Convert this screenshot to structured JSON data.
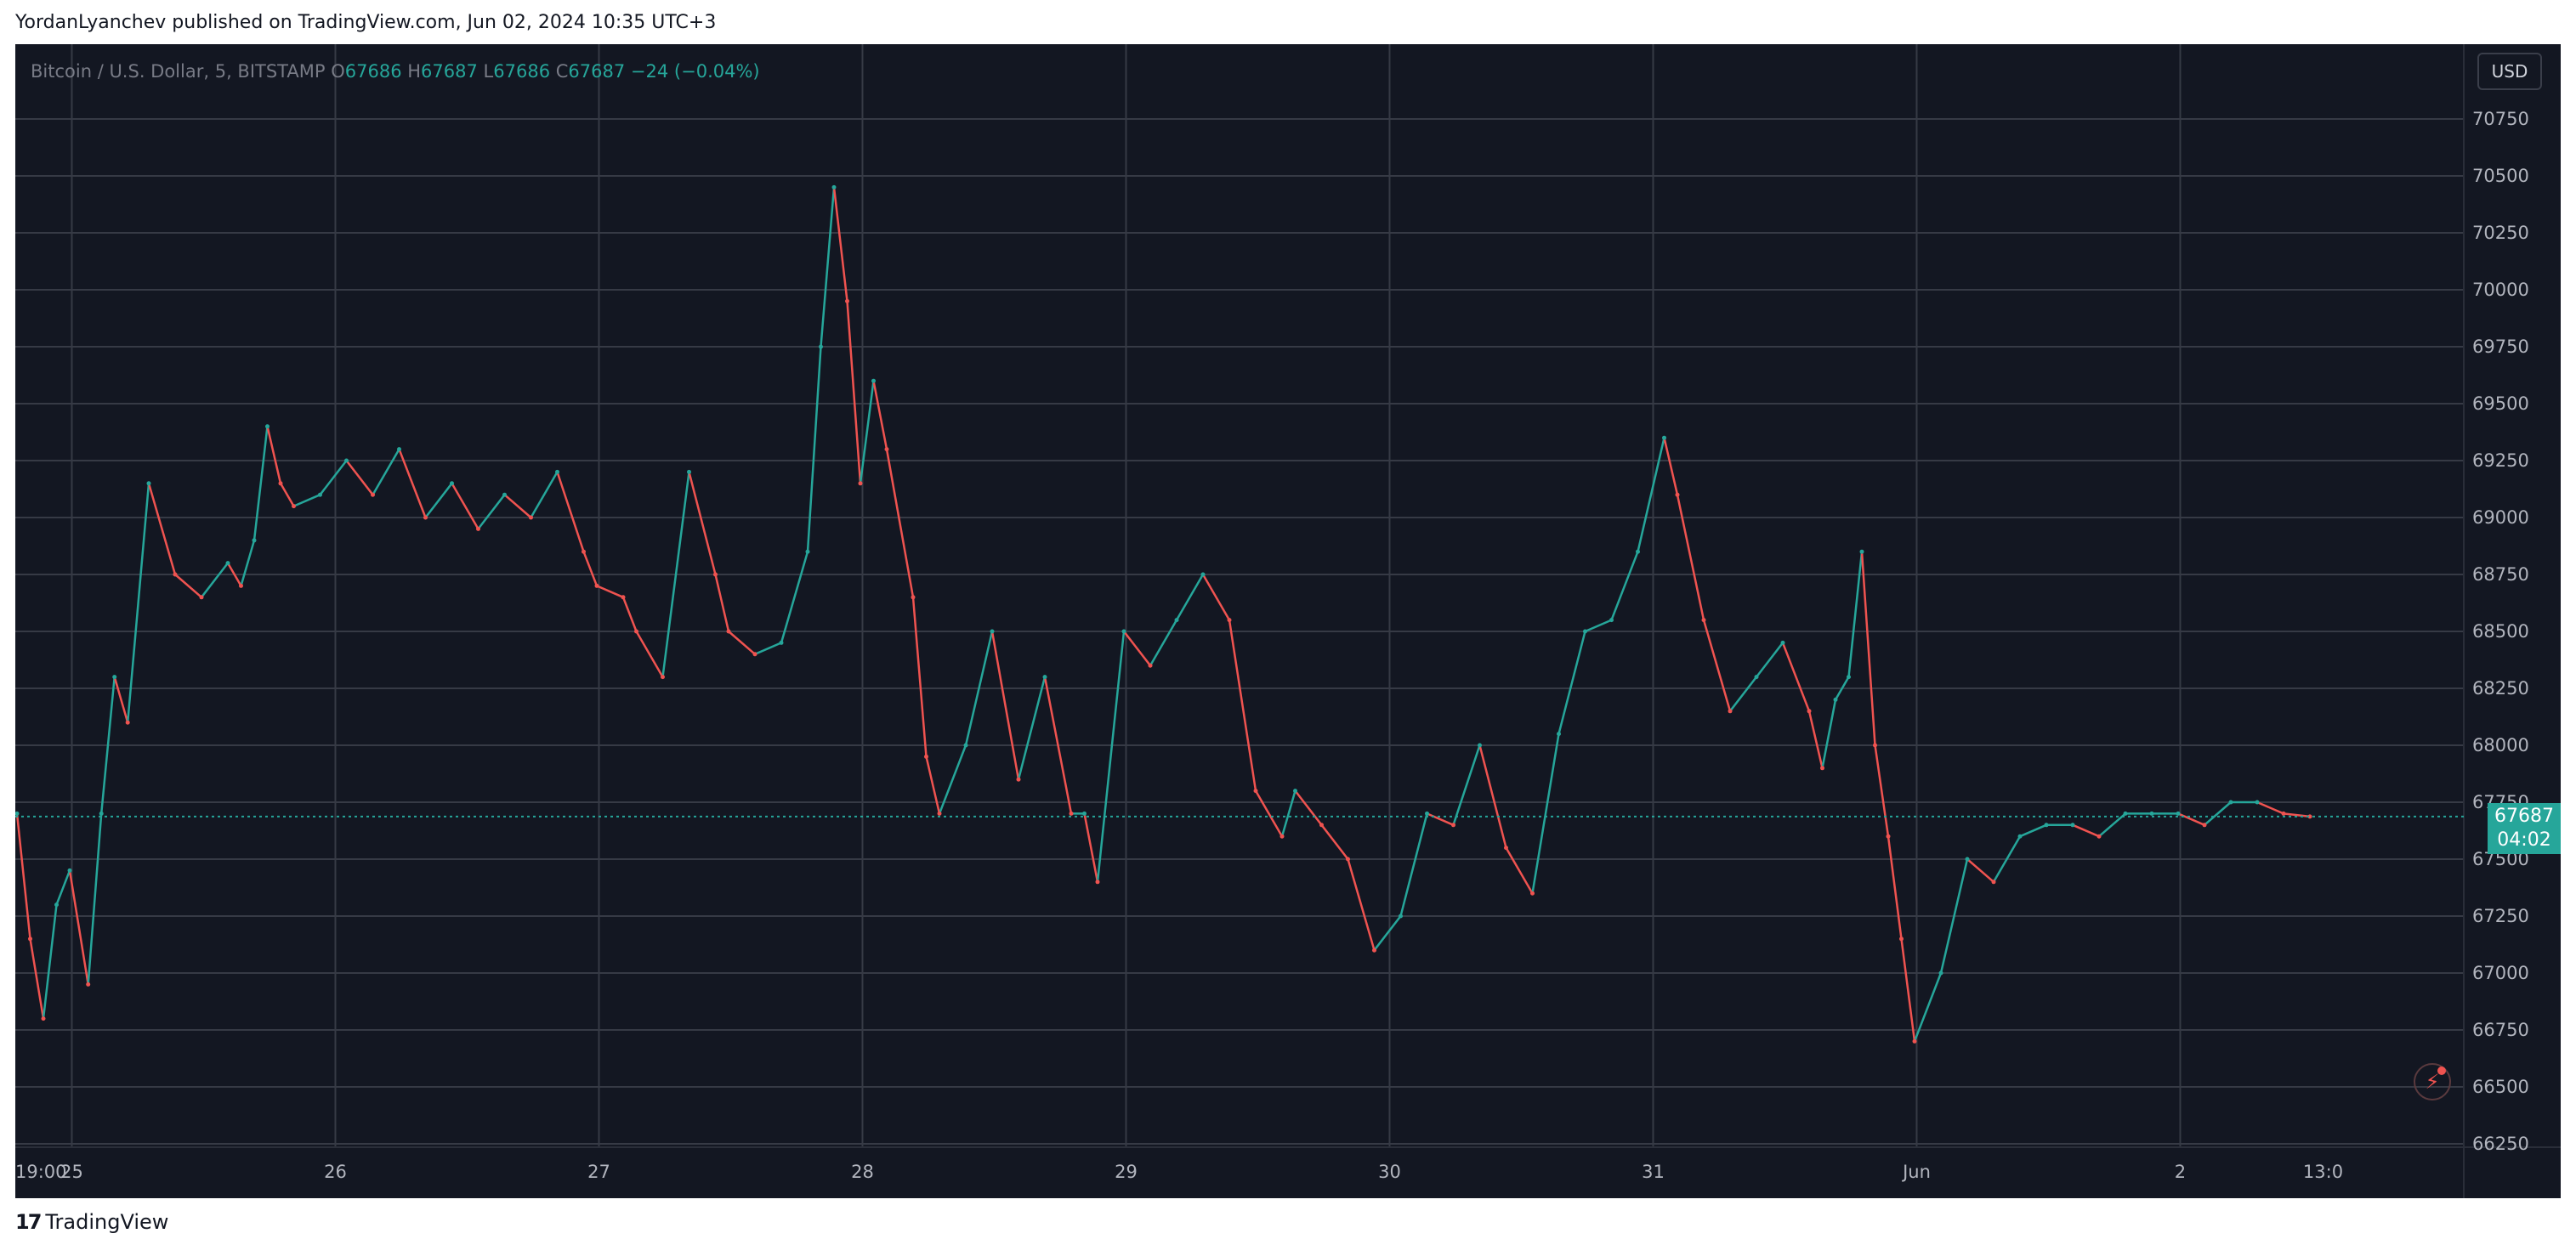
{
  "header": {
    "text": "YordanLyanchev published on TradingView.com, Jun 02, 2024 10:35 UTC+3"
  },
  "legend": {
    "symbol": "Bitcoin / U.S. Dollar, 5, BITSTAMP",
    "o_label": "O",
    "o_value": "67686",
    "h_label": "H",
    "h_value": "67687",
    "l_label": "L",
    "l_value": "67686",
    "c_label": "C",
    "c_value": "67687",
    "change": "−24 (−0.04%)"
  },
  "currency_button": "USD",
  "last_price": {
    "value": "67687",
    "countdown": "04:02"
  },
  "colors": {
    "up": "#26a69a",
    "down": "#ef5350",
    "background": "#131722",
    "grid": "#363a45",
    "axis_text": "#b2b5be"
  },
  "icons": {
    "alert": "lightning-bolt-icon",
    "logo": "tradingview-logo-icon"
  },
  "footer": {
    "brand": "TradingView"
  },
  "chart_data": {
    "type": "line",
    "title": "Bitcoin / U.S. Dollar, 5, BITSTAMP",
    "xlabel": "",
    "ylabel": "",
    "ylim": [
      66250,
      70750
    ],
    "y_ticks": [
      66250,
      66500,
      66750,
      67000,
      67250,
      67500,
      67750,
      68000,
      68250,
      68500,
      68750,
      69000,
      69250,
      69500,
      69750,
      70000,
      70250,
      70500,
      70750
    ],
    "x_ticks": [
      {
        "label": "19:00",
        "x": 0.0
      },
      {
        "label": "25",
        "x": 0.208
      },
      {
        "label": "26",
        "x": 1.208
      },
      {
        "label": "27",
        "x": 2.208
      },
      {
        "label": "28",
        "x": 3.208
      },
      {
        "label": "29",
        "x": 4.208
      },
      {
        "label": "30",
        "x": 5.208
      },
      {
        "label": "31",
        "x": 6.208
      },
      {
        "label": "Jun",
        "x": 7.208
      },
      {
        "label": "2",
        "x": 8.208
      },
      {
        "label": "13:0",
        "x": 8.75
      }
    ],
    "grid": true,
    "last_value": 67687,
    "series": [
      {
        "x": [
          0.0,
          0.05,
          0.1,
          0.15,
          0.2,
          0.27,
          0.32,
          0.37,
          0.42,
          0.5,
          0.6,
          0.7,
          0.8,
          0.85,
          0.9,
          0.95,
          1.0,
          1.05,
          1.15,
          1.25,
          1.35,
          1.45,
          1.55,
          1.65,
          1.75,
          1.85,
          1.95,
          2.05,
          2.15,
          2.2,
          2.3,
          2.35,
          2.45,
          2.55,
          2.65,
          2.7,
          2.8,
          2.9,
          3.0,
          3.05,
          3.1,
          3.15,
          3.2,
          3.25,
          3.3,
          3.4,
          3.45,
          3.5,
          3.6,
          3.7,
          3.8,
          3.9,
          4.0,
          4.05,
          4.1,
          4.2,
          4.3,
          4.4,
          4.5,
          4.6,
          4.7,
          4.8,
          4.85,
          4.95,
          5.05,
          5.15,
          5.25,
          5.35,
          5.45,
          5.55,
          5.65,
          5.75,
          5.85,
          5.95,
          6.05,
          6.15,
          6.25,
          6.3,
          6.4,
          6.5,
          6.6,
          6.7,
          6.8,
          6.85,
          6.9,
          6.95,
          7.0,
          7.05,
          7.1,
          7.15,
          7.2,
          7.3,
          7.4,
          7.5,
          7.6,
          7.7,
          7.8,
          7.9,
          8.0,
          8.1,
          8.2,
          8.3,
          8.4,
          8.5,
          8.6,
          8.7
        ],
        "values": [
          67700,
          67150,
          66800,
          67300,
          67450,
          66950,
          67700,
          68300,
          68100,
          69150,
          68750,
          68650,
          68800,
          68700,
          68900,
          69400,
          69150,
          69050,
          69100,
          69250,
          69100,
          69300,
          69000,
          69150,
          68950,
          69100,
          69000,
          69200,
          68850,
          68700,
          68650,
          68500,
          68300,
          69200,
          68750,
          68500,
          68400,
          68450,
          68850,
          69750,
          70450,
          69950,
          69150,
          69600,
          69300,
          68650,
          67950,
          67700,
          68000,
          68500,
          67850,
          68300,
          67700,
          67700,
          67400,
          68500,
          68350,
          68550,
          68750,
          68550,
          67800,
          67600,
          67800,
          67650,
          67500,
          67100,
          67250,
          67700,
          67650,
          68000,
          67550,
          67350,
          68050,
          68500,
          68550,
          68850,
          69350,
          69100,
          68550,
          68150,
          68300,
          68450,
          68150,
          67900,
          68200,
          68300,
          68850,
          68000,
          67600,
          67150,
          66700,
          67000,
          67500,
          67400,
          67600,
          67650,
          67650,
          67600,
          67700,
          67700,
          67700,
          67650,
          67750,
          67750,
          67700,
          67687
        ]
      }
    ]
  }
}
